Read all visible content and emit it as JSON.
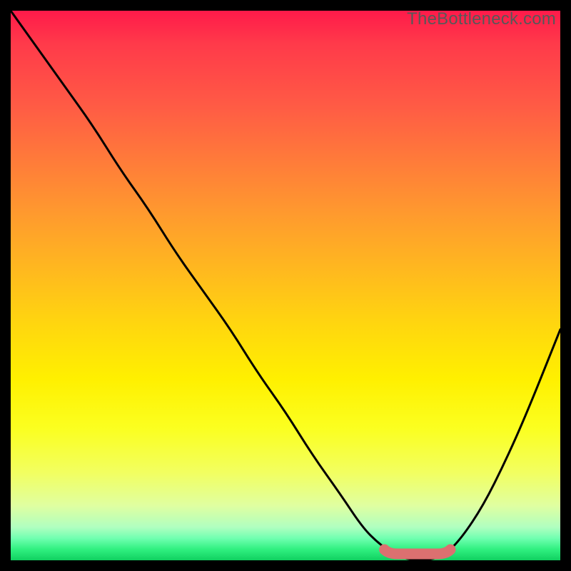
{
  "attribution": "TheBottleneck.com",
  "colors": {
    "curve_stroke": "#000000",
    "notch_fill": "#dc7070",
    "frame": "#000000"
  },
  "chart_data": {
    "type": "line",
    "title": "",
    "xlabel": "",
    "ylabel": "",
    "xlim": [
      0,
      100
    ],
    "ylim": [
      0,
      100
    ],
    "series": [
      {
        "name": "bottleneck-curve",
        "x": [
          0,
          5,
          10,
          15,
          20,
          25,
          30,
          35,
          40,
          45,
          50,
          55,
          60,
          64,
          67,
          70,
          73,
          76,
          79,
          82,
          86,
          90,
          94,
          100
        ],
        "values": [
          100,
          93,
          86,
          79,
          71,
          64,
          56,
          49,
          42,
          34,
          27,
          19,
          12,
          6,
          3,
          1,
          0,
          0,
          1,
          4,
          10,
          18,
          27,
          42
        ]
      }
    ],
    "annotations": [
      {
        "name": "optimal-range",
        "x_start": 68,
        "x_end": 80,
        "y": 0
      }
    ],
    "gradient_stops": [
      {
        "pos": 0,
        "color": "#ff1a4a"
      },
      {
        "pos": 50,
        "color": "#ffd000"
      },
      {
        "pos": 100,
        "color": "#10d060"
      }
    ]
  }
}
